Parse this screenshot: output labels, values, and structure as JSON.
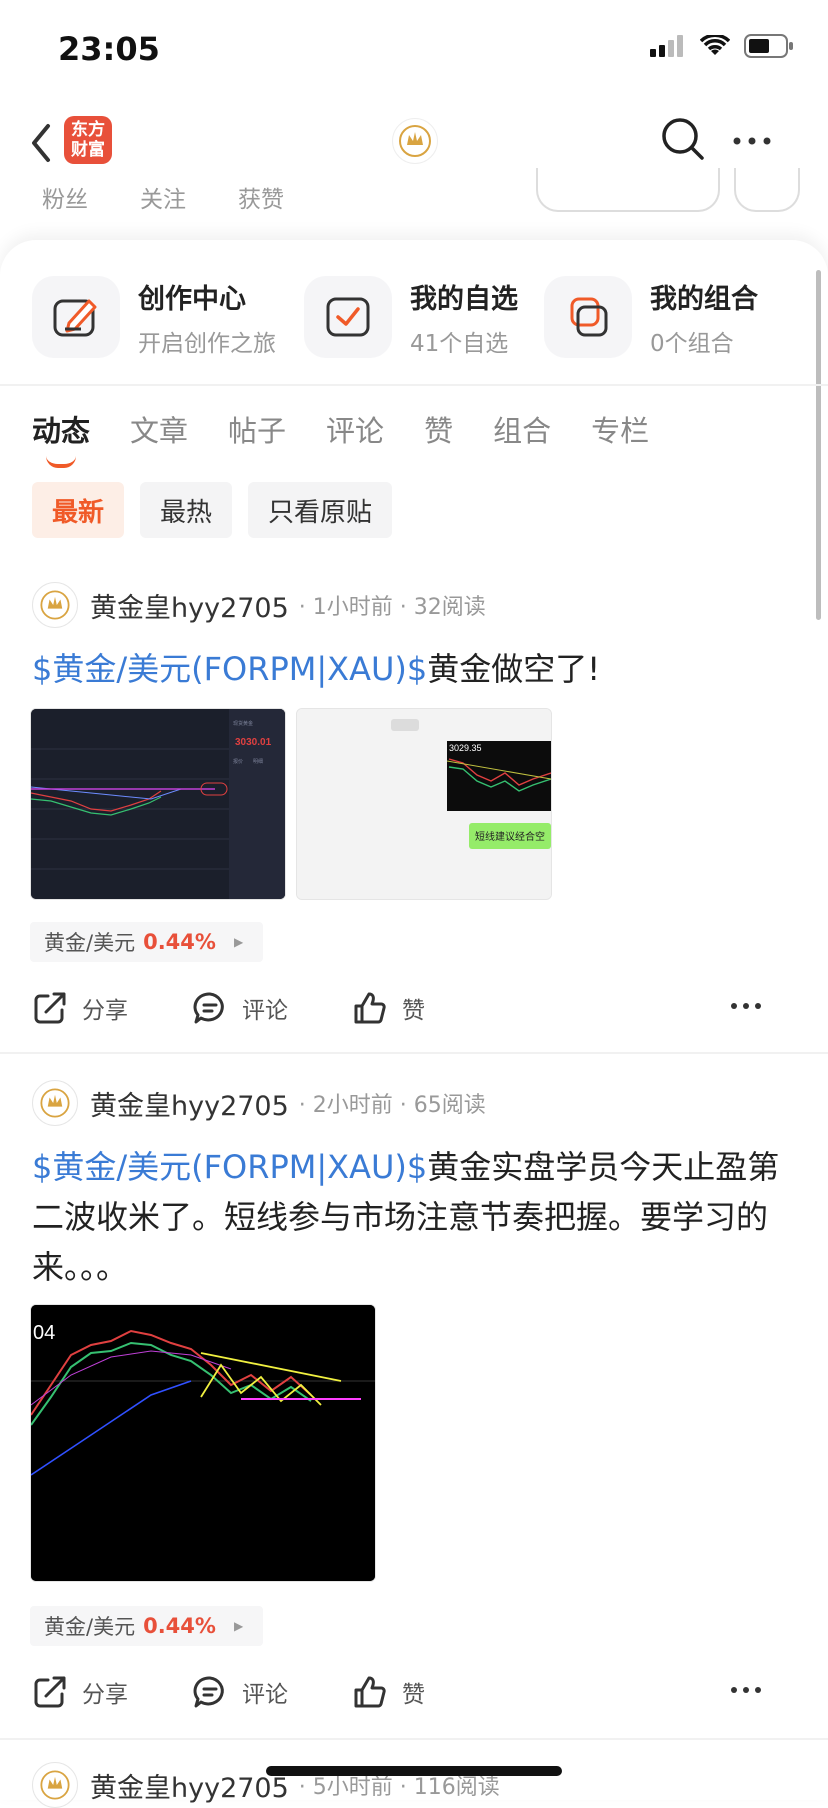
{
  "status": {
    "time": "23:05"
  },
  "header": {
    "logo_text": "东方\n财富",
    "back_icon": "chevron-left-icon",
    "search_icon": "search-icon",
    "more_icon": "more-horizontal-icon"
  },
  "profile_stats": [
    "粉丝",
    "关注",
    "获赞"
  ],
  "quick_actions": [
    {
      "title": "创作中心",
      "subtitle": "开启创作之旅",
      "icon": "edit-icon"
    },
    {
      "title": "我的自选",
      "subtitle": "41个自选",
      "icon": "checkbox-icon"
    },
    {
      "title": "我的组合",
      "subtitle": "0个组合",
      "icon": "portfolio-icon"
    }
  ],
  "tabs": [
    "动态",
    "文章",
    "帖子",
    "评论",
    "赞",
    "组合",
    "专栏"
  ],
  "active_tab": "动态",
  "filters": [
    "最新",
    "最热",
    "只看原贴"
  ],
  "active_filter": "最新",
  "posts": [
    {
      "author": "黄金皇hyy2705",
      "meta": "· 1小时前 · 32阅读",
      "link": "$黄金/美元(FORPM|XAU)$",
      "text": "黄金做空了!",
      "chart_price": "3030.01",
      "chart_label": "短线建议经合空",
      "chart_small_price": "3029.35",
      "tag_name": "黄金/美元",
      "tag_pct": "0.44%"
    },
    {
      "author": "黄金皇hyy2705",
      "meta": "· 2小时前 · 65阅读",
      "link": "$黄金/美元(FORPM|XAU)$",
      "text": "黄金实盘学员今天止盈第二波收米了。短线参与市场注意节奏把握。要学习的来。。。",
      "chart_label": "04",
      "tag_name": "黄金/美元",
      "tag_pct": "0.44%"
    },
    {
      "author": "黄金皇hyy2705",
      "meta": "· 5小时前 · 116阅读"
    }
  ],
  "actions": {
    "share": "分享",
    "comment": "评论",
    "like": "赞"
  },
  "colors": {
    "accent": "#f05a28",
    "link": "#3a7bd5",
    "up": "#e8503a"
  }
}
